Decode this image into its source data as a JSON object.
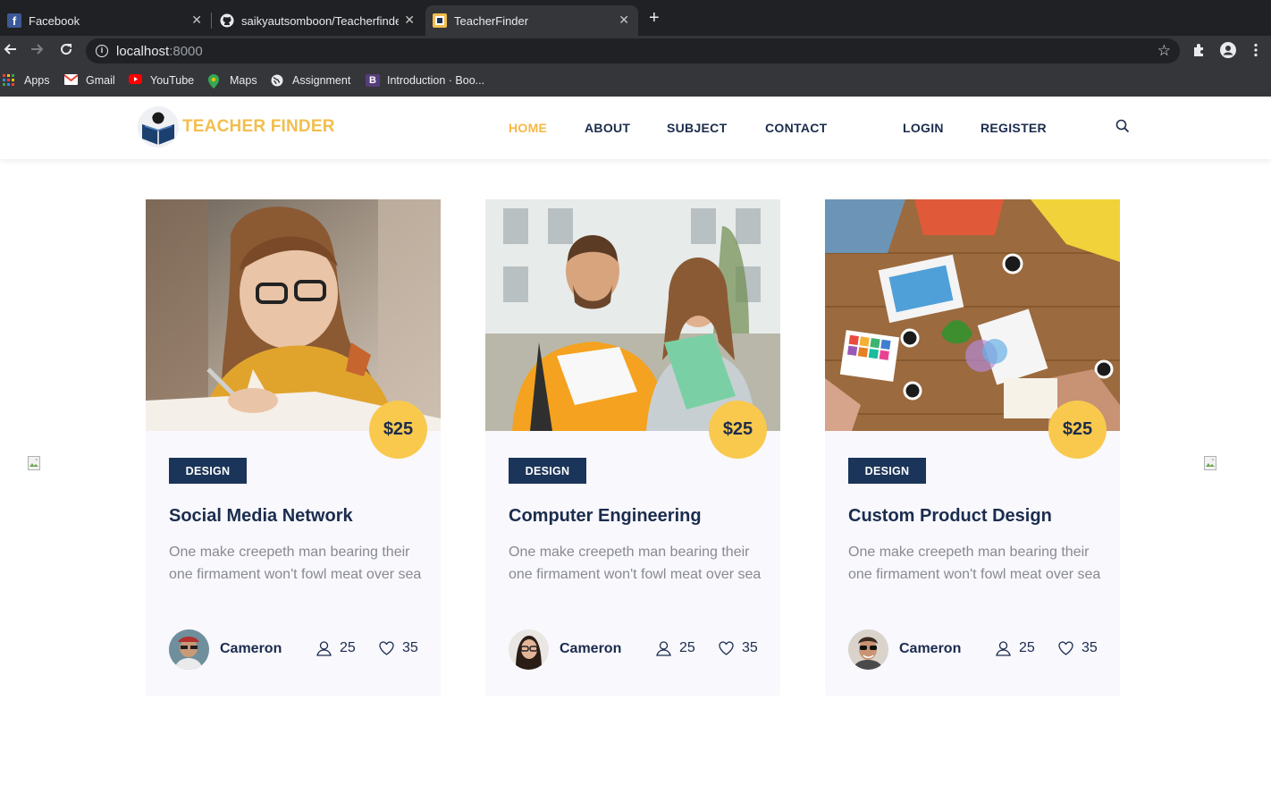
{
  "browser": {
    "tabs": [
      {
        "title": "Facebook",
        "active": false
      },
      {
        "title": "saikyautsomboon/Teacherfinde",
        "active": false
      },
      {
        "title": "TeacherFinder",
        "active": true
      }
    ],
    "url_host": "localhost",
    "url_port": ":8000",
    "bookmarks": [
      "Apps",
      "Gmail",
      "YouTube",
      "Maps",
      "Assignment",
      "Introduction · Boo..."
    ]
  },
  "site": {
    "logo_text": "TEACHER FINDER",
    "nav": [
      "HOME",
      "ABOUT",
      "SUBJECT",
      "CONTACT",
      "LOGIN",
      "REGISTER"
    ],
    "active_nav": "HOME"
  },
  "cards": [
    {
      "price": "$25",
      "tag": "DESIGN",
      "title": "Social Media Network",
      "desc": "One make creepeth man bearing their one firmament won't fowl meat over sea",
      "author": "Cameron",
      "students": "25",
      "likes": "35"
    },
    {
      "price": "$25",
      "tag": "DESIGN",
      "title": "Computer Engineering",
      "desc": "One make creepeth man bearing their one firmament won't fowl meat over sea",
      "author": "Cameron",
      "students": "25",
      "likes": "35"
    },
    {
      "price": "$25",
      "tag": "DESIGN",
      "title": "Custom Product Design",
      "desc": "One make creepeth man bearing their one firmament won't fowl meat over sea",
      "author": "Cameron",
      "students": "25",
      "likes": "35"
    }
  ],
  "colors": {
    "accent_yellow": "#f9c94e",
    "navy": "#1b2c4d",
    "tag_bg": "#1b3459"
  }
}
